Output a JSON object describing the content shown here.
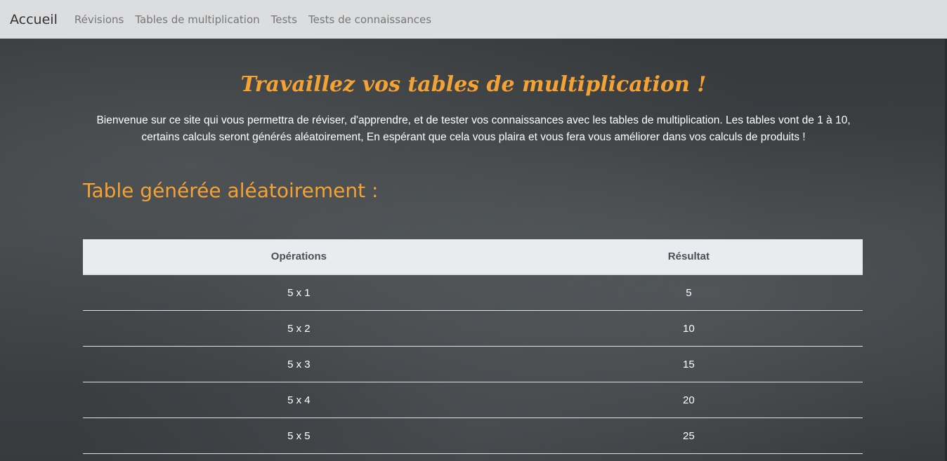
{
  "nav": {
    "brand": "Accueil",
    "links": [
      "Révisions",
      "Tables de multiplication",
      "Tests",
      "Tests de connaissances"
    ]
  },
  "hero": {
    "title": "Travaillez vos tables de multiplication !",
    "intro": "Bienvenue sur ce site qui vous permettra de réviser, d'apprendre, et de tester vos connaissances avec les tables de multiplication. Les tables vont de 1 à 10, certains calculs seront générés aléatoirement, En espérant que cela vous plaira et vous fera vous améliorer dans vos calculs de produits !"
  },
  "section": {
    "title": "Table générée aléatoirement :"
  },
  "table": {
    "headers": [
      "Opérations",
      "Résultat"
    ],
    "rows": [
      [
        "5 x 1",
        "5"
      ],
      [
        "5 x 2",
        "10"
      ],
      [
        "5 x 3",
        "15"
      ],
      [
        "5 x 4",
        "20"
      ],
      [
        "5 x 5",
        "25"
      ]
    ]
  },
  "colors": {
    "accent": "#f4a233",
    "navbar": "#dcdddf",
    "board": "#3a3d40"
  }
}
